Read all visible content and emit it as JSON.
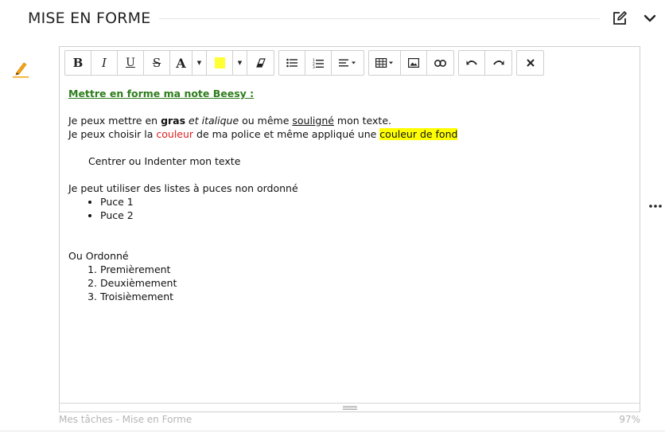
{
  "header": {
    "title": "MISE EN FORME",
    "edit_icon": "edit-square-icon",
    "collapse_icon": "chevron-down-icon"
  },
  "toolbar": {
    "bold": "B",
    "italic": "I",
    "underline": "U",
    "strike": "S",
    "font_color": "A",
    "highlight_color": "#ffff00",
    "icons": [
      "eraser-icon",
      "bulleted-list-icon",
      "numbered-list-icon",
      "align-icon",
      "table-icon",
      "image-icon",
      "link-icon",
      "undo-icon",
      "redo-icon",
      "close-icon"
    ]
  },
  "content": {
    "title": "Mettre en forme ma note Beesy :",
    "line1_a": "Je peux mettre en ",
    "line1_bold": "gras",
    "line1_italic": "et italique",
    "line1_b": " ou même ",
    "line1_under": "souligné",
    "line1_c": " mon texte.",
    "line2_a": "Je peux choisir la ",
    "line2_red": "couleur",
    "line2_b": " de ma police et même appliqué une ",
    "line2_highlight": "couleur de fond ",
    "centered": "Centrer ou Indenter mon texte",
    "bullets_intro": "Je peut utiliser des listes à puces non ordonné",
    "bullets": [
      "Puce 1",
      "Puce 2"
    ],
    "ordered_intro": "Ou Ordonné",
    "ordered": [
      "Premièrement",
      "Deuxièmement",
      "Troisièmement"
    ],
    "red_color": "#e02020",
    "green_color": "#2e7d1d"
  },
  "footer": {
    "path": "Mes tâches - Mise en Forme",
    "zoom": "97%"
  }
}
